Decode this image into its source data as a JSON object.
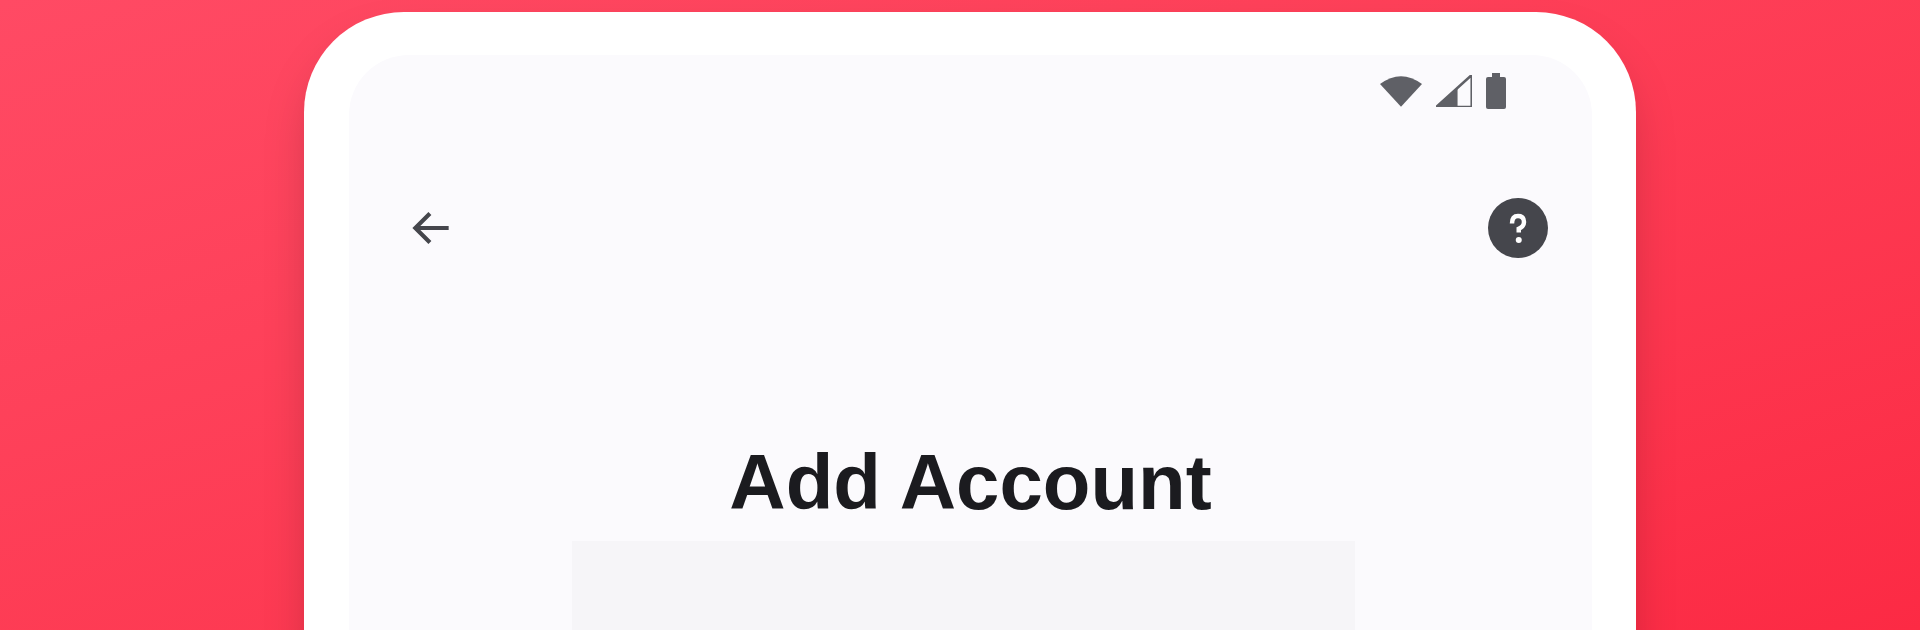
{
  "screen": {
    "title": "Add Account"
  }
}
